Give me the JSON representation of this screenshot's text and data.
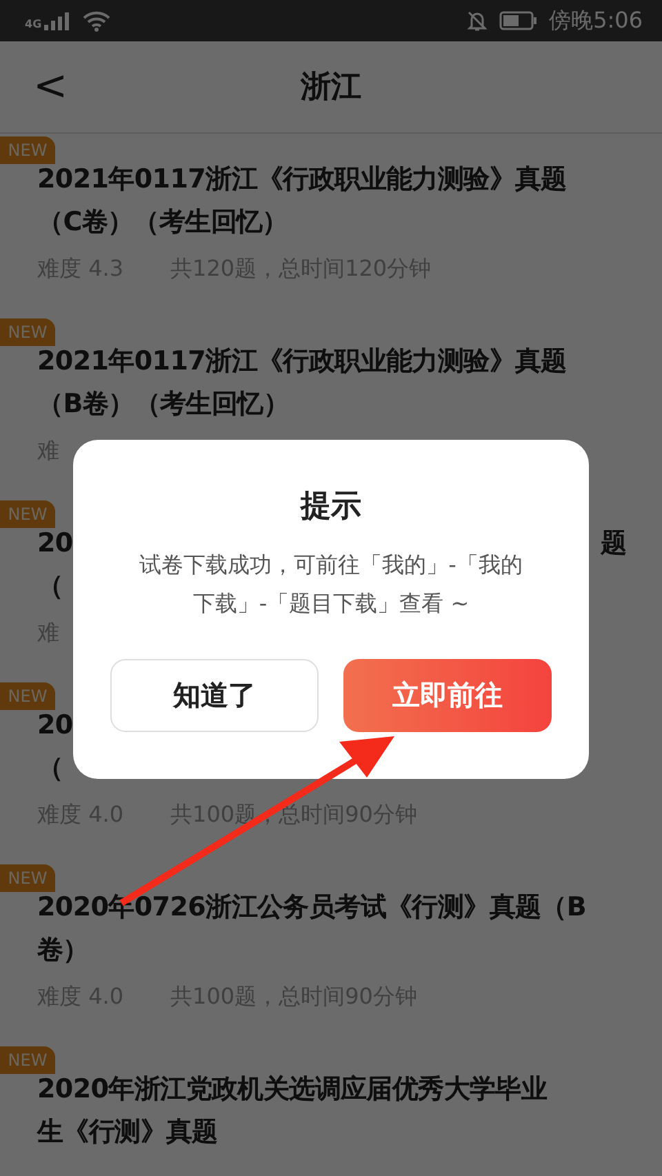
{
  "status_bar": {
    "network": "4G",
    "time": "傍晚5:06"
  },
  "header": {
    "back": "<",
    "title": "浙江"
  },
  "papers": [
    {
      "badge": "NEW",
      "lines": [
        {
          "text": "2021年0117浙江《行政职业能力测验》真题"
        },
        {
          "text": "（C卷）（考生回忆）"
        }
      ],
      "difficulty": "难度 4.3",
      "summary": "共120题，总时间120分钟"
    },
    {
      "badge": "NEW",
      "lines": [
        {
          "text": "2021年0117浙江《行政职业能力测验》真题"
        },
        {
          "text": "（B卷）（考生回忆）"
        }
      ],
      "difficulty": "难"
    },
    {
      "badge": "NEW",
      "lines": [
        {
          "text": "20",
          "end": "题"
        },
        {
          "text": "（"
        }
      ],
      "difficulty": "难"
    },
    {
      "badge": "NEW",
      "lines": [
        {
          "text": "20"
        },
        {
          "text": "（"
        }
      ],
      "difficulty": "难度 4.0",
      "summary": "共100题，总时间90分钟"
    },
    {
      "badge": "NEW",
      "lines": [
        {
          "text": "2020年0726浙江公务员考试《行测》真题（B"
        },
        {
          "text": "卷）"
        }
      ],
      "difficulty": "难度 4.0",
      "summary": "共100题，总时间90分钟"
    },
    {
      "badge": "NEW",
      "lines": [
        {
          "text": "2020年浙江党政机关选调应届优秀大学毕业"
        },
        {
          "text": "生《行测》真题"
        }
      ]
    }
  ],
  "dialog": {
    "title": "提示",
    "message": "试卷下载成功，可前往「我的」-「我的下载」-「题目下载」查看 ~",
    "buttons": [
      {
        "label": "知道了",
        "kind": "secondary"
      },
      {
        "label": "立即前往",
        "kind": "primary"
      }
    ]
  }
}
